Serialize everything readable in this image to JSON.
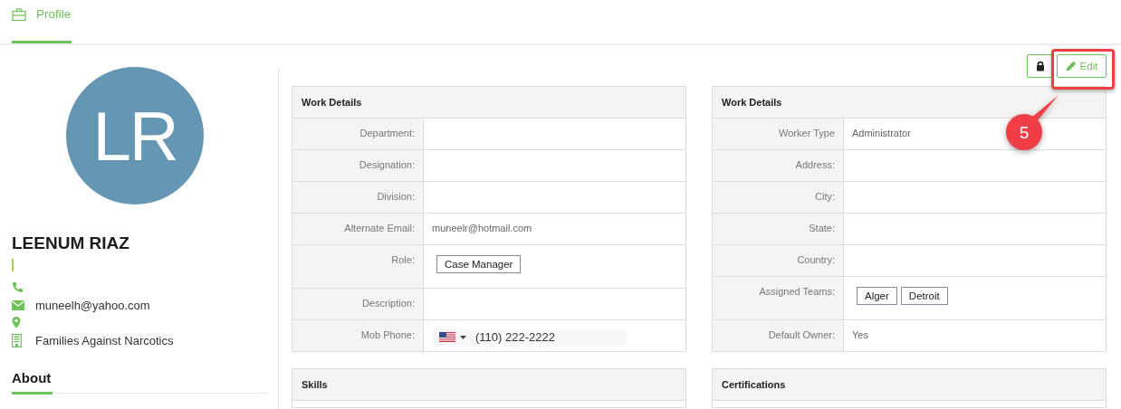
{
  "tabs": [
    {
      "label": "Profile",
      "selected": true
    }
  ],
  "profile": {
    "initials": "LR",
    "name": "LEENUM RIAZ",
    "contacts": [
      {
        "kind": "phone"
      },
      {
        "kind": "email",
        "text": "muneelh@yahoo.com"
      },
      {
        "kind": "location"
      },
      {
        "kind": "organization",
        "text": "Families Against Narcotics"
      }
    ],
    "about_heading": "About"
  },
  "toolbar": {
    "buttons": [
      {
        "kind": "lock"
      },
      {
        "kind": "edit",
        "label": "Edit"
      }
    ]
  },
  "annotation": {
    "label": "5"
  },
  "panels": [
    {
      "title": "Work Details",
      "rows": [
        {
          "label": "Department:",
          "kind": "text"
        },
        {
          "label": "Designation:",
          "kind": "text"
        },
        {
          "label": "Division:",
          "kind": "text"
        },
        {
          "label": "Alternate Email:",
          "kind": "text",
          "value": "muneelr@hotmail.com"
        },
        {
          "label": "Role:",
          "kind": "tags",
          "tags": [
            "Case Manager"
          ]
        },
        {
          "label": "Description:",
          "kind": "text"
        },
        {
          "label": "Mob Phone:",
          "kind": "phone",
          "value": "(110) 222-2222"
        }
      ]
    },
    {
      "title": "Work Details",
      "rows": [
        {
          "label": "Worker Type",
          "kind": "text",
          "value": "Administrator"
        },
        {
          "label": "Address:",
          "kind": "text"
        },
        {
          "label": "City:",
          "kind": "text"
        },
        {
          "label": "State:",
          "kind": "text"
        },
        {
          "label": "Country:",
          "kind": "text"
        },
        {
          "label": "Assigned Teams:",
          "kind": "tags",
          "tags": [
            "Alger",
            "Detroit"
          ]
        },
        {
          "label": "Default Owner:",
          "kind": "text",
          "value": "Yes"
        }
      ]
    },
    {
      "title": "Skills"
    },
    {
      "title": "Certifications"
    }
  ]
}
